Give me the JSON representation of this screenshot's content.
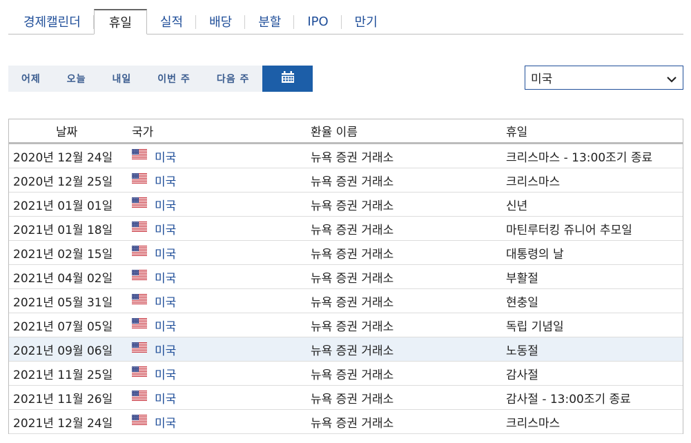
{
  "tabs": [
    {
      "label": "경제캘린더"
    },
    {
      "label": "휴일"
    },
    {
      "label": "실적"
    },
    {
      "label": "배당"
    },
    {
      "label": "분할"
    },
    {
      "label": "IPO"
    },
    {
      "label": "만기"
    }
  ],
  "active_tab_index": 1,
  "range_buttons": [
    {
      "label": "어제"
    },
    {
      "label": "오늘"
    },
    {
      "label": "내일"
    },
    {
      "label": "이번 주"
    },
    {
      "label": "다음 주"
    }
  ],
  "calendar_icon": "calendar-icon",
  "country_select": {
    "value": "미국"
  },
  "table": {
    "headers": {
      "date": "날짜",
      "country": "국가",
      "exchange": "환율 이름",
      "holiday": "휴일"
    },
    "rows": [
      {
        "date": "2020년 12월 24일",
        "country": "미국",
        "exchange": "뉴욕 증권 거래소",
        "holiday": "크리스마스 - 13:00조기 종료"
      },
      {
        "date": "2020년 12월 25일",
        "country": "미국",
        "exchange": "뉴욕 증권 거래소",
        "holiday": "크리스마스"
      },
      {
        "date": "2021년 01월 01일",
        "country": "미국",
        "exchange": "뉴욕 증권 거래소",
        "holiday": "신년"
      },
      {
        "date": "2021년 01월 18일",
        "country": "미국",
        "exchange": "뉴욕 증권 거래소",
        "holiday": "마틴루터킹 쥬니어 추모일"
      },
      {
        "date": "2021년 02월 15일",
        "country": "미국",
        "exchange": "뉴욕 증권 거래소",
        "holiday": "대통령의 날"
      },
      {
        "date": "2021년 04월 02일",
        "country": "미국",
        "exchange": "뉴욕 증권 거래소",
        "holiday": "부활절"
      },
      {
        "date": "2021년 05월 31일",
        "country": "미국",
        "exchange": "뉴욕 증권 거래소",
        "holiday": "현충일"
      },
      {
        "date": "2021년 07월 05일",
        "country": "미국",
        "exchange": "뉴욕 증권 거래소",
        "holiday": "독립 기념일"
      },
      {
        "date": "2021년 09월 06일",
        "country": "미국",
        "exchange": "뉴욕 증권 거래소",
        "holiday": "노동절"
      },
      {
        "date": "2021년 11월 25일",
        "country": "미국",
        "exchange": "뉴욕 증권 거래소",
        "holiday": "감사절"
      },
      {
        "date": "2021년 11월 26일",
        "country": "미국",
        "exchange": "뉴욕 증권 거래소",
        "holiday": "감사절 - 13:00조기 종료"
      },
      {
        "date": "2021년 12월 24일",
        "country": "미국",
        "exchange": "뉴욕 증권 거래소",
        "holiday": "크리스마스"
      }
    ],
    "highlighted_row_index": 8
  },
  "colors": {
    "accent": "#1c5ea8",
    "link": "#1f4e99",
    "highlight_row": "#eaf1f8"
  }
}
